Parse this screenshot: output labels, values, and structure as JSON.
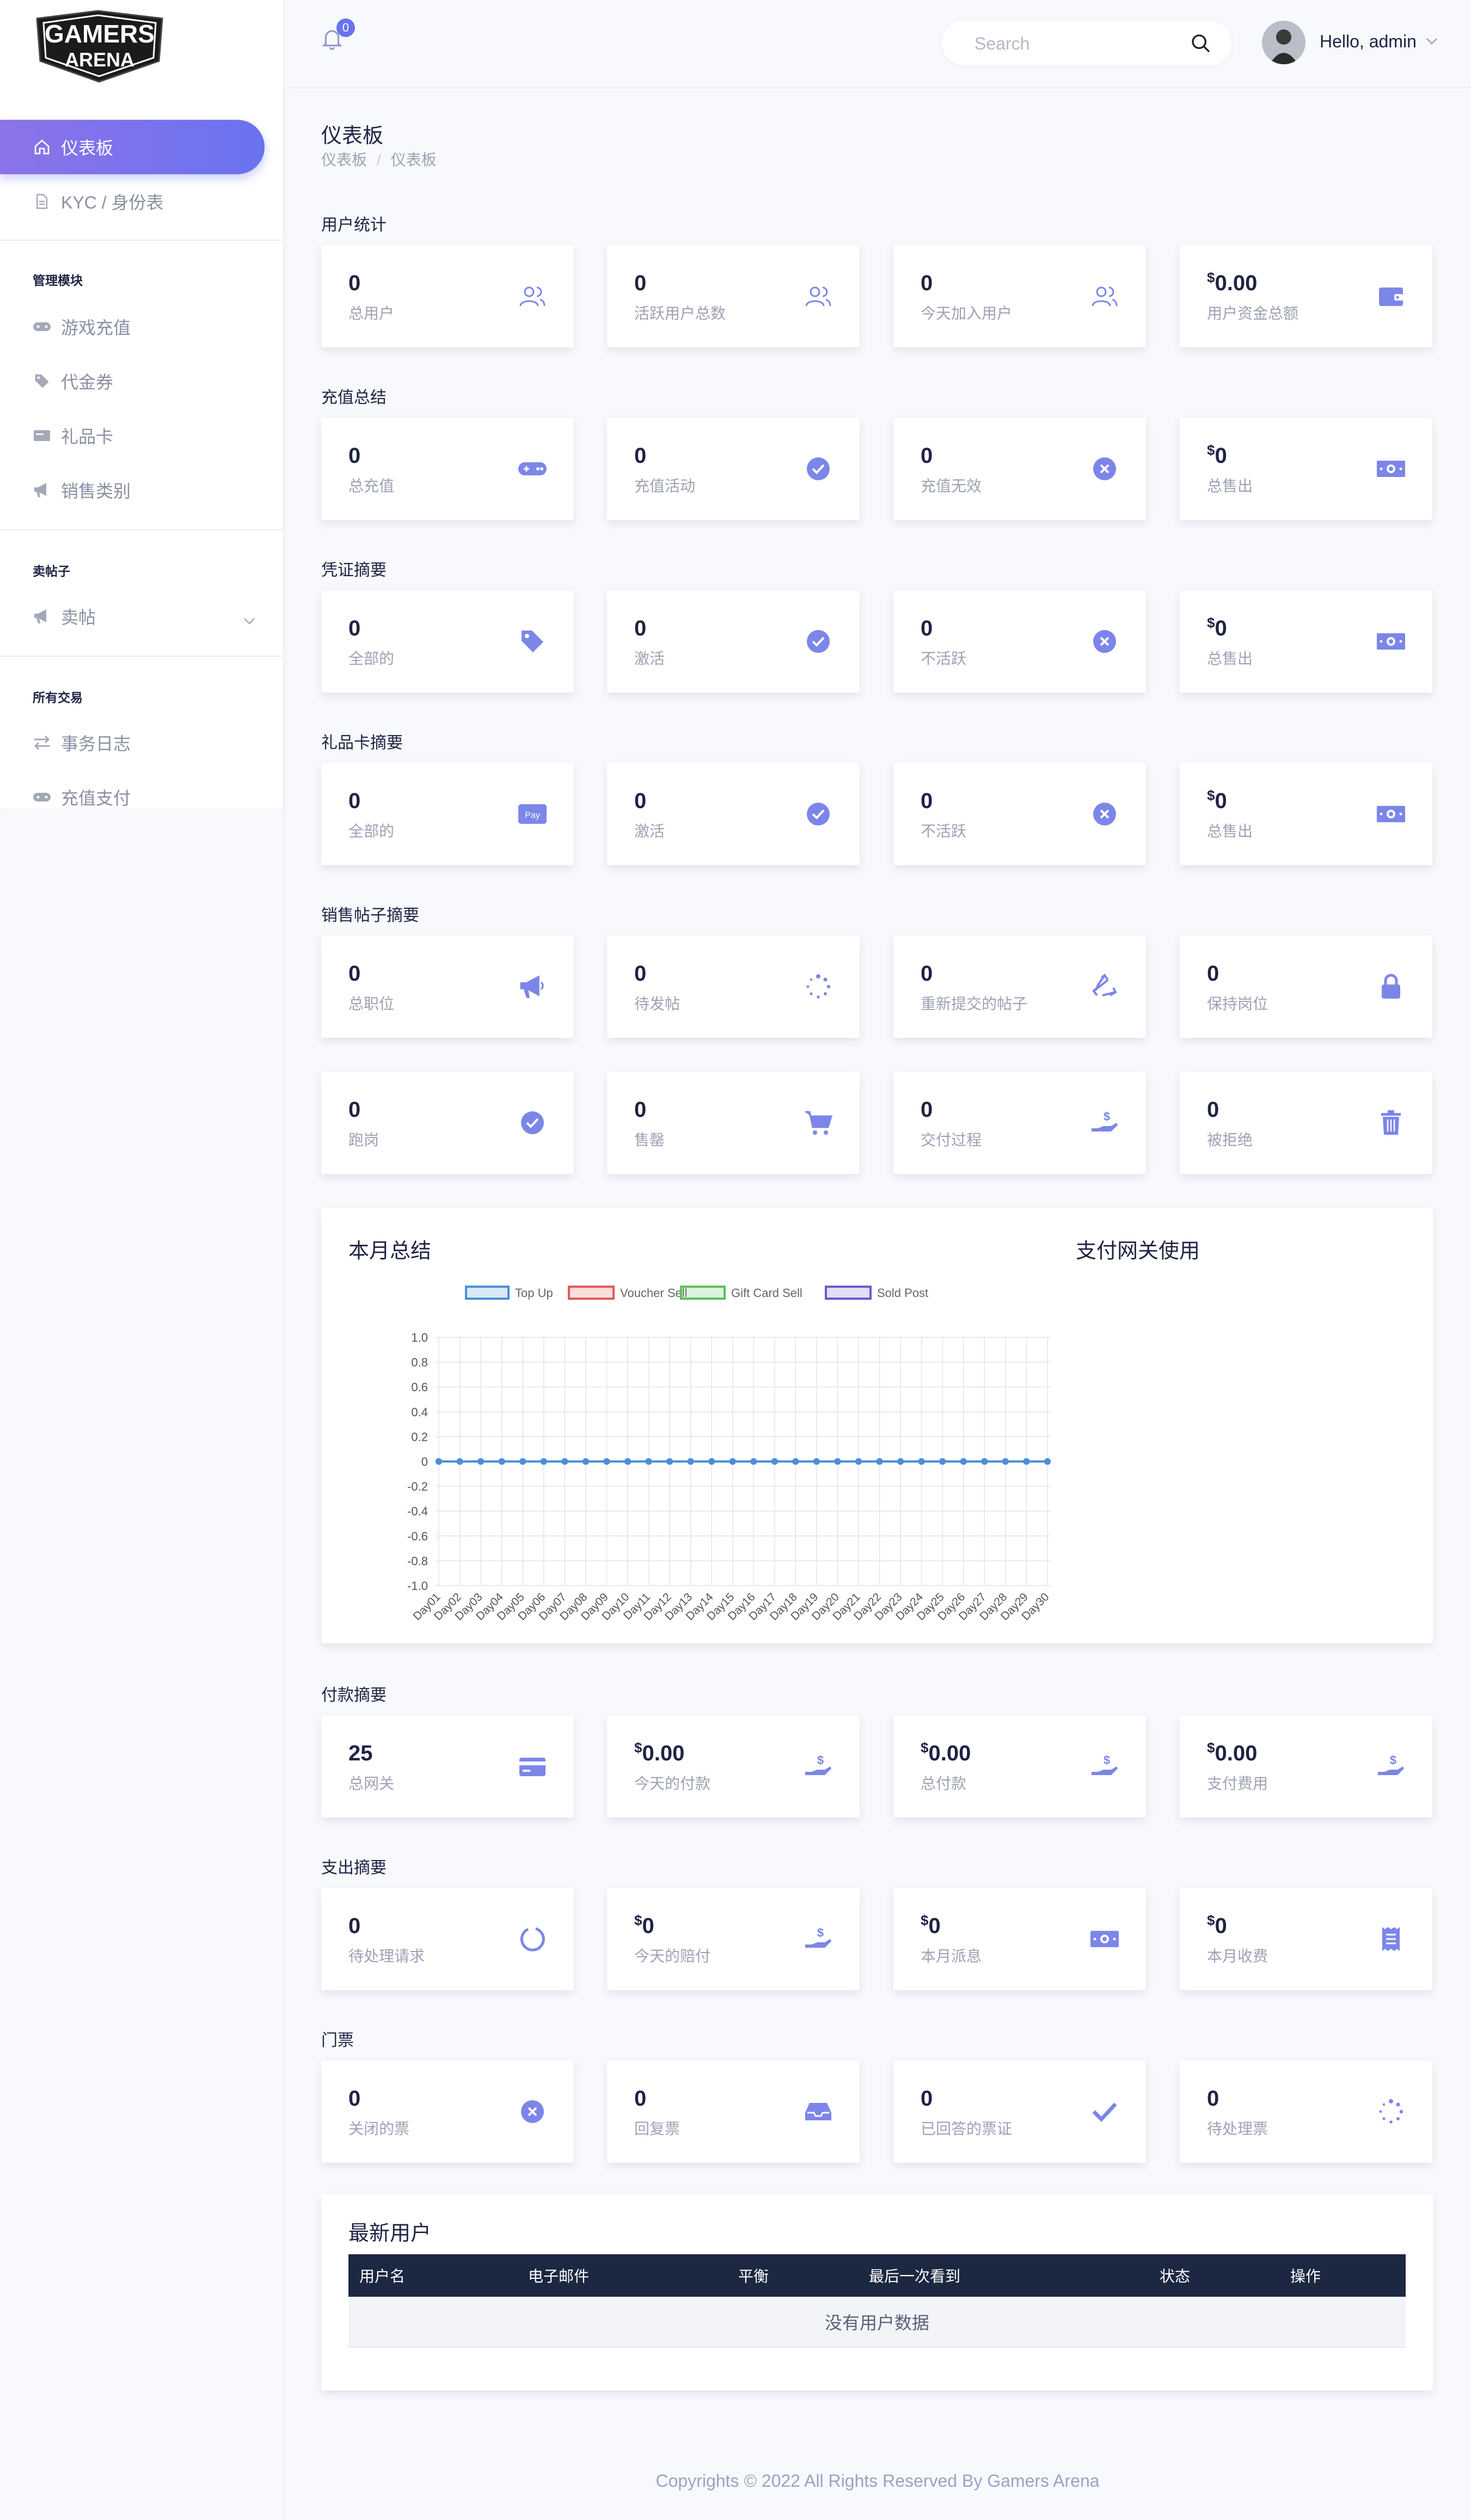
{
  "logo": {
    "text_top": "GAMERS",
    "text_bottom": "ARENA"
  },
  "sidebar": {
    "active_item": {
      "label": "仪表板",
      "icon": "home-icon"
    },
    "items_top": [
      {
        "label": "KYC / 身份表",
        "icon": "document-icon"
      }
    ],
    "group1": {
      "title": "管理模块",
      "items": [
        {
          "label": "游戏充值",
          "icon": "gamepad-icon"
        },
        {
          "label": "代金券",
          "icon": "tag-icon"
        },
        {
          "label": "礼品卡",
          "icon": "card-icon"
        },
        {
          "label": "销售类别",
          "icon": "megaphone-icon"
        }
      ]
    },
    "group2": {
      "title": "卖帖子",
      "items": [
        {
          "label": "卖帖",
          "icon": "megaphone-icon"
        }
      ]
    },
    "group3": {
      "title": "所有交易",
      "items": [
        {
          "label": "事务日志",
          "icon": "exchange-icon"
        },
        {
          "label": "充值支付",
          "icon": "gamepad-icon"
        }
      ]
    }
  },
  "topbar": {
    "notification_count": "0",
    "search_placeholder": "Search",
    "greeting": "Hello, admin"
  },
  "page": {
    "title": "仪表板",
    "breadcrumb": [
      "仪表板",
      "仪表板"
    ]
  },
  "sections": {
    "user_stats": {
      "title": "用户统计",
      "cards": [
        {
          "value": "0",
          "label": "总用户",
          "icon": "users-icon"
        },
        {
          "value": "0",
          "label": "活跃用户总数",
          "icon": "users-icon"
        },
        {
          "value": "0",
          "label": "今天加入用户",
          "icon": "users-icon"
        },
        {
          "currency": "$",
          "value": "0.00",
          "label": "用户资金总额",
          "icon": "wallet-icon"
        }
      ]
    },
    "topup_summary": {
      "title": "充值总结",
      "cards": [
        {
          "value": "0",
          "label": "总充值",
          "icon": "gamepad-icon"
        },
        {
          "value": "0",
          "label": "充值活动",
          "icon": "check-circle-icon"
        },
        {
          "value": "0",
          "label": "充值无效",
          "icon": "x-circle-icon"
        },
        {
          "currency": "$",
          "value": "0",
          "label": "总售出",
          "icon": "money-icon"
        }
      ]
    },
    "voucher_summary": {
      "title": "凭证摘要",
      "cards": [
        {
          "value": "0",
          "label": "全部的",
          "icon": "tag-icon"
        },
        {
          "value": "0",
          "label": "激活",
          "icon": "check-circle-icon"
        },
        {
          "value": "0",
          "label": "不活跃",
          "icon": "x-circle-icon"
        },
        {
          "currency": "$",
          "value": "0",
          "label": "总售出",
          "icon": "money-icon"
        }
      ]
    },
    "giftcard_summary": {
      "title": "礼品卡摘要",
      "cards": [
        {
          "value": "0",
          "label": "全部的",
          "icon": "apple-pay-icon",
          "icon_text": "Pay"
        },
        {
          "value": "0",
          "label": "激活",
          "icon": "check-circle-icon"
        },
        {
          "value": "0",
          "label": "不活跃",
          "icon": "x-circle-icon"
        },
        {
          "currency": "$",
          "value": "0",
          "label": "总售出",
          "icon": "money-icon"
        }
      ]
    },
    "sellpost_summary": {
      "title": "销售帖子摘要",
      "cards": [
        {
          "value": "0",
          "label": "总职位",
          "icon": "megaphone-icon"
        },
        {
          "value": "0",
          "label": "待发帖",
          "icon": "spinner-icon"
        },
        {
          "value": "0",
          "label": "重新提交的帖子",
          "icon": "recycle-icon"
        },
        {
          "value": "0",
          "label": "保持岗位",
          "icon": "lock-icon"
        },
        {
          "value": "0",
          "label": "跑岗",
          "icon": "check-circle-icon"
        },
        {
          "value": "0",
          "label": "售罄",
          "icon": "cart-icon"
        },
        {
          "value": "0",
          "label": "交付过程",
          "icon": "hand-dollar-icon"
        },
        {
          "value": "0",
          "label": "被拒绝",
          "icon": "trash-icon"
        }
      ]
    },
    "payment_summary": {
      "title": "付款摘要",
      "cards": [
        {
          "value": "25",
          "label": "总网关",
          "icon": "credit-card-icon"
        },
        {
          "currency": "$",
          "value": "0.00",
          "label": "今天的付款",
          "icon": "hand-dollar-icon"
        },
        {
          "currency": "$",
          "value": "0.00",
          "label": "总付款",
          "icon": "hand-dollar-icon"
        },
        {
          "currency": "$",
          "value": "0.00",
          "label": "支付费用",
          "icon": "hand-dollar-icon"
        }
      ]
    },
    "payout_summary": {
      "title": "支出摘要",
      "cards": [
        {
          "value": "0",
          "label": "待处理请求",
          "icon": "circle-notch-icon"
        },
        {
          "currency": "$",
          "value": "0",
          "label": "今天的赔付",
          "icon": "hand-dollar-icon"
        },
        {
          "currency": "$",
          "value": "0",
          "label": "本月派息",
          "icon": "money-icon"
        },
        {
          "currency": "$",
          "value": "0",
          "label": "本月收费",
          "icon": "receipt-icon"
        }
      ]
    },
    "tickets": {
      "title": "门票",
      "cards": [
        {
          "value": "0",
          "label": "关闭的票",
          "icon": "x-circle-icon"
        },
        {
          "value": "0",
          "label": "回复票",
          "icon": "inbox-icon"
        },
        {
          "value": "0",
          "label": "已回答的票证",
          "icon": "check-icon"
        },
        {
          "value": "0",
          "label": "待处理票",
          "icon": "spinner-icon"
        }
      ]
    }
  },
  "monthly_panel": {
    "title": "本月总结",
    "gateway_title": "支付网关使用"
  },
  "chart_data": {
    "type": "line",
    "title": "本月总结",
    "x": [
      "Day01",
      "Day02",
      "Day03",
      "Day04",
      "Day05",
      "Day06",
      "Day07",
      "Day08",
      "Day09",
      "Day10",
      "Day11",
      "Day12",
      "Day13",
      "Day14",
      "Day15",
      "Day16",
      "Day17",
      "Day18",
      "Day19",
      "Day20",
      "Day21",
      "Day22",
      "Day23",
      "Day24",
      "Day25",
      "Day26",
      "Day27",
      "Day28",
      "Day29",
      "Day30"
    ],
    "series": [
      {
        "name": "Top Up",
        "color": "#4a90d9",
        "values": [
          0,
          0,
          0,
          0,
          0,
          0,
          0,
          0,
          0,
          0,
          0,
          0,
          0,
          0,
          0,
          0,
          0,
          0,
          0,
          0,
          0,
          0,
          0,
          0,
          0,
          0,
          0,
          0,
          0,
          0
        ]
      },
      {
        "name": "Voucher Sell",
        "color": "#e05a5a",
        "values": [
          0,
          0,
          0,
          0,
          0,
          0,
          0,
          0,
          0,
          0,
          0,
          0,
          0,
          0,
          0,
          0,
          0,
          0,
          0,
          0,
          0,
          0,
          0,
          0,
          0,
          0,
          0,
          0,
          0,
          0
        ]
      },
      {
        "name": "Gift Card Sell",
        "color": "#5cc05c",
        "values": [
          0,
          0,
          0,
          0,
          0,
          0,
          0,
          0,
          0,
          0,
          0,
          0,
          0,
          0,
          0,
          0,
          0,
          0,
          0,
          0,
          0,
          0,
          0,
          0,
          0,
          0,
          0,
          0,
          0,
          0
        ]
      },
      {
        "name": "Sold Post",
        "color": "#6a5acd",
        "values": [
          0,
          0,
          0,
          0,
          0,
          0,
          0,
          0,
          0,
          0,
          0,
          0,
          0,
          0,
          0,
          0,
          0,
          0,
          0,
          0,
          0,
          0,
          0,
          0,
          0,
          0,
          0,
          0,
          0,
          0
        ]
      }
    ],
    "yticks": [
      "1.0",
      "0.8",
      "0.6",
      "0.4",
      "0.2",
      "0",
      "-0.2",
      "-0.4",
      "-0.6",
      "-0.8",
      "-1.0"
    ],
    "ylim": [
      -1,
      1
    ],
    "grid": true,
    "legend": "top"
  },
  "latest_users": {
    "title": "最新用户",
    "columns": [
      "用户名",
      "电子邮件",
      "平衡",
      "最后一次看到",
      "状态",
      "操作"
    ],
    "empty_text": "没有用户数据"
  },
  "footer": {
    "text": "Copyrights © 2022 All Rights Reserved By Gamers Arena"
  },
  "colors": {
    "accent": "#6a73f0",
    "icon": "#7c86e8",
    "table_header": "#1c2741"
  }
}
